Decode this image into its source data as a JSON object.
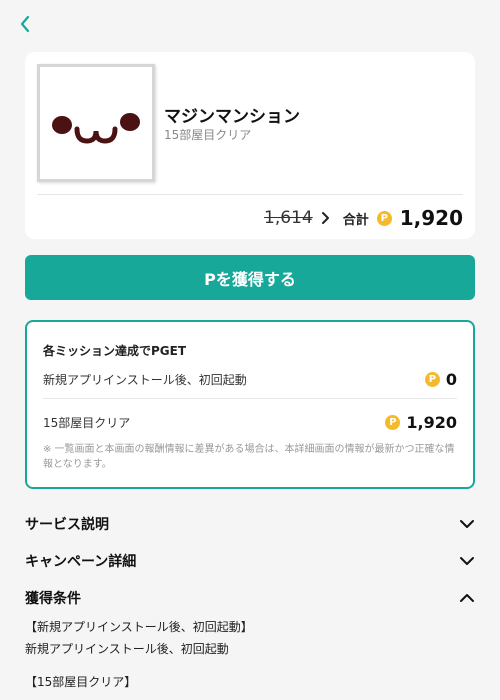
{
  "app": {
    "name": "マジンマンション",
    "subtitle": "15部屋目クリア"
  },
  "pricing": {
    "old_price": "1,614",
    "total_label": "合計",
    "total_value": "1,920",
    "coin_symbol": "P"
  },
  "cta": {
    "label": "Pを獲得する"
  },
  "missions": {
    "title": "各ミッション達成でPGET",
    "items": [
      {
        "label": "新規アプリインストール後、初回起動",
        "points": "0"
      },
      {
        "label": "15部屋目クリア",
        "points": "1,920"
      }
    ],
    "note": "※ 一覧画面と本画面の報酬情報に差異がある場合は、本詳細画面の情報が最新かつ正確な情報となります。"
  },
  "sections": [
    {
      "title": "サービス説明",
      "expanded": false
    },
    {
      "title": "キャンペーン詳細",
      "expanded": false
    },
    {
      "title": "獲得条件",
      "expanded": true
    }
  ],
  "conditions": {
    "line1": "【新規アプリインストール後、初回起動】",
    "line2": "新規アプリインストール後、初回起動",
    "line3": "【15部屋目クリア】"
  },
  "colors": {
    "accent": "#17a899",
    "coin": "#f5b92c",
    "background": "#f5f5f5"
  }
}
